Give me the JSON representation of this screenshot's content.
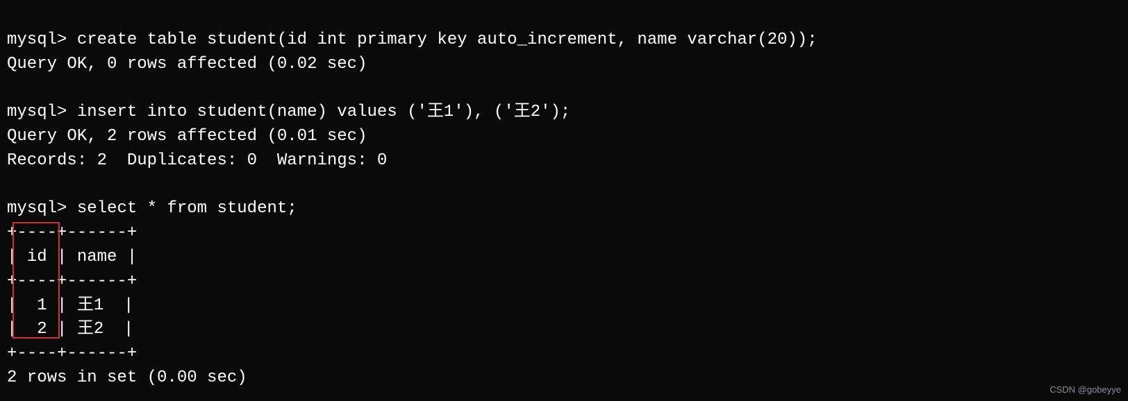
{
  "prompt": "mysql> ",
  "cmd1": "create table student(id int primary key auto_increment, name varchar(20));",
  "res1": "Query OK, 0 rows affected (0.02 sec)",
  "cmd2": "insert into student(name) values ('王1'), ('王2');",
  "res2a": "Query OK, 2 rows affected (0.01 sec)",
  "res2b": "Records: 2  Duplicates: 0  Warnings: 0",
  "cmd3": "select * from student;",
  "table": {
    "border": "+----+------+",
    "header": "| id | name |",
    "rows": [
      "|  1 | 王1  |",
      "|  2 | 王2  |"
    ]
  },
  "res3": "2 rows in set (0.00 sec)",
  "watermark": "CSDN @gobeyye",
  "chart_data": {
    "type": "table",
    "title": "student",
    "columns": [
      "id",
      "name"
    ],
    "rows": [
      {
        "id": 1,
        "name": "王1"
      },
      {
        "id": 2,
        "name": "王2"
      }
    ]
  }
}
